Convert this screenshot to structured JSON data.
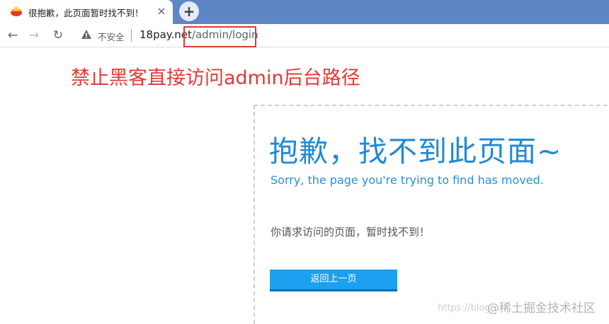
{
  "browser": {
    "tab": {
      "title": "很抱歉，此页面暂时找不到！",
      "close_glyph": "×"
    },
    "new_tab_glyph": "+",
    "toolbar": {
      "back_glyph": "←",
      "forward_glyph": "→",
      "reload_glyph": "↻",
      "security_label": "不安全",
      "url_host": "18pay.net",
      "url_path": "/admin/login"
    }
  },
  "annotation": {
    "text": "禁止黑客直接访问admin后台路径",
    "color": "#e53935"
  },
  "page": {
    "title": "抱歉，找不到此页面~",
    "subtitle": "Sorry, the page you're trying to find has moved.",
    "message": "你请求访问的页面，暂时找不到！",
    "back_button_label": "返回上一页"
  },
  "watermark": {
    "url": "https://blog",
    "brand": "@稀土掘金技术社区"
  },
  "colors": {
    "tab_bar": "#5f86c4",
    "title_blue": "#1f8ad6",
    "button_blue": "#1ca0ef",
    "highlight_red": "#d93d35"
  }
}
